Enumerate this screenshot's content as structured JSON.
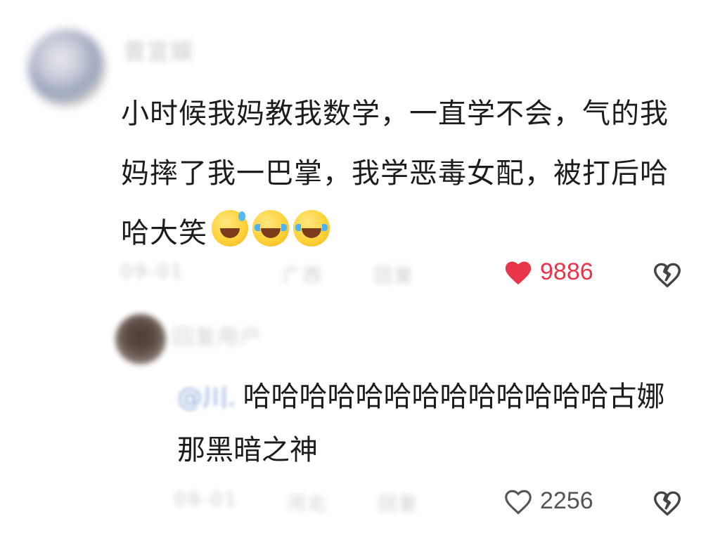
{
  "comment": {
    "username": "曾宜娱",
    "text": "小时候我妈教我数学，一直学不会，气的我妈摔了我一巴掌，我学恶毒女配，被打后哈哈大笑",
    "emoji": [
      "sweat-grin-emoji",
      "tears-of-joy-emoji",
      "tears-of-joy-emoji"
    ],
    "meta": [
      "09-01",
      "广西",
      "回复"
    ],
    "likes": "9886",
    "liked": true,
    "like_color": "#e8354a"
  },
  "reply": {
    "username": "回复用户",
    "mention": "@川.",
    "text": "哈哈哈哈哈哈哈哈哈哈哈哈哈古娜那黑暗之神",
    "meta": [
      "09-01",
      "河北",
      "回复"
    ],
    "likes": "2256",
    "liked": false
  }
}
